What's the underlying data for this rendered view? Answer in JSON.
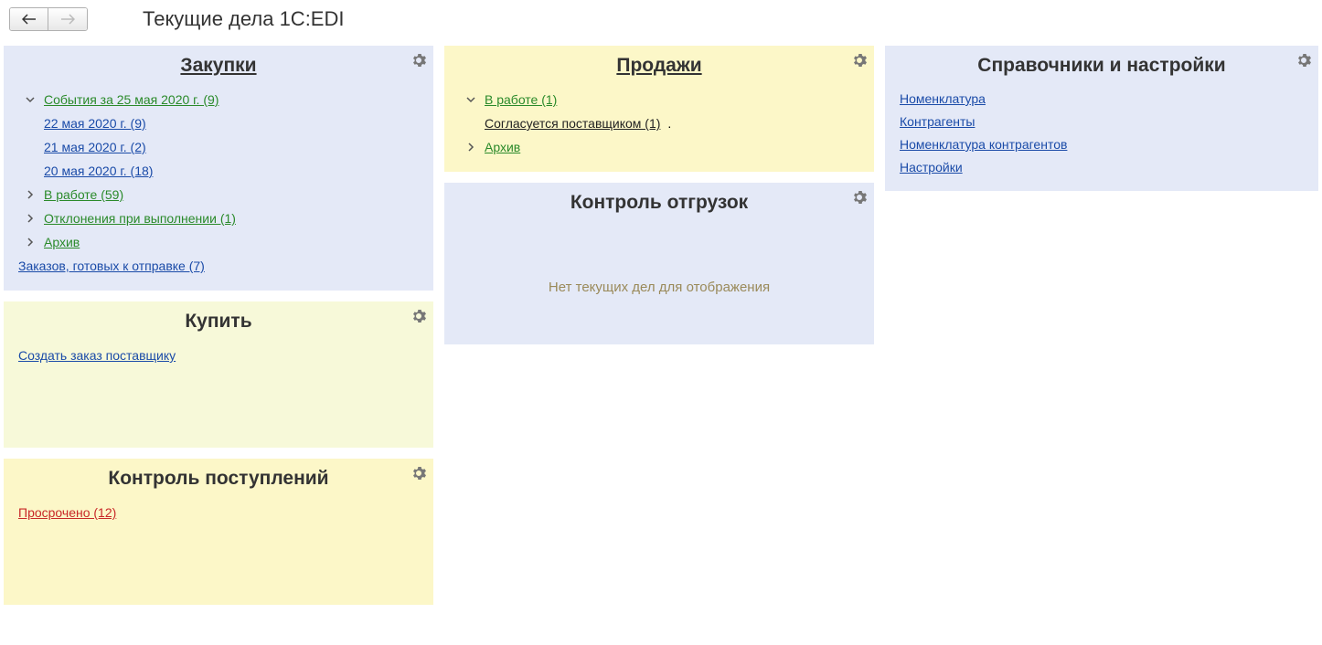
{
  "header": {
    "title": "Текущие дела 1C:EDI"
  },
  "purchases": {
    "title": "Закупки",
    "events_today": "События за 25 мая 2020 г. (9)",
    "dates": [
      "22 мая 2020 г. (9)",
      "21 мая 2020 г. (2)",
      "20 мая 2020 г. (18)"
    ],
    "in_work": "В работе (59)",
    "deviations": "Отклонения при выполнении (1)",
    "archive": "Архив",
    "ready_orders": "Заказов, готовых к отправке (7)"
  },
  "buy": {
    "title": "Купить",
    "create_order": "Создать заказ поставщику"
  },
  "receipts": {
    "title": "Контроль поступлений",
    "overdue": "Просрочено (12)"
  },
  "sales": {
    "title": "Продажи",
    "in_work": "В работе (1)",
    "agreed": "Согласуется поставщиком (1)",
    "archive": "Архив"
  },
  "shipments": {
    "title": "Контроль отгрузок",
    "empty": "Нет текущих дел для отображения"
  },
  "settings": {
    "title": "Справочники и настройки",
    "links": {
      "nomenclature": "Номенклатура",
      "counterparties": "Контрагенты",
      "counterparty_nomenclature": "Номенклатура контрагентов",
      "settings": "Настройки"
    }
  }
}
